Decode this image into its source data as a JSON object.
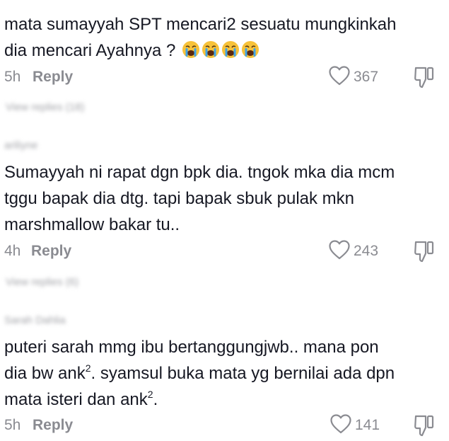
{
  "comments": [
    {
      "text_line1": "mata sumayyah SPT mencari2 sesuatu mungkinkah",
      "text_line2": "dia mencari Ayahnya ?",
      "emoji": [
        "crying-face",
        "crying-face",
        "crying-face",
        "crying-face"
      ],
      "time": "5h",
      "reply_label": "Reply",
      "likes": "367",
      "view_replies": "View replies (18)"
    },
    {
      "username": "ariliyne",
      "text_line1": "Sumayyah ni rapat dgn bpk dia. tngok mka dia mcm",
      "text_line2": "tggu bapak dia dtg. tapi bapak sbuk pulak mkn",
      "text_line3": "marshmallow bakar tu..",
      "time": "4h",
      "reply_label": "Reply",
      "likes": "243",
      "view_replies": "View replies (6)"
    },
    {
      "username": "Sarah Dahlia",
      "text_line1": "puteri sarah mmg ibu bertanggungjwb.. mana pon",
      "text_line2_prefix": "dia bw ank",
      "text_line2_sup": "2",
      "text_line2_suffix": ". syamsul buka mata yg bernilai ada dpn",
      "text_line3_prefix": "mata isteri dan ank",
      "text_line3_sup": "2",
      "text_line3_suffix": ".",
      "time": "5h",
      "reply_label": "Reply",
      "likes": "141"
    }
  ],
  "colors": {
    "text": "#161823",
    "secondary": "#8a8b91",
    "blurred": "#a2a3a8"
  }
}
